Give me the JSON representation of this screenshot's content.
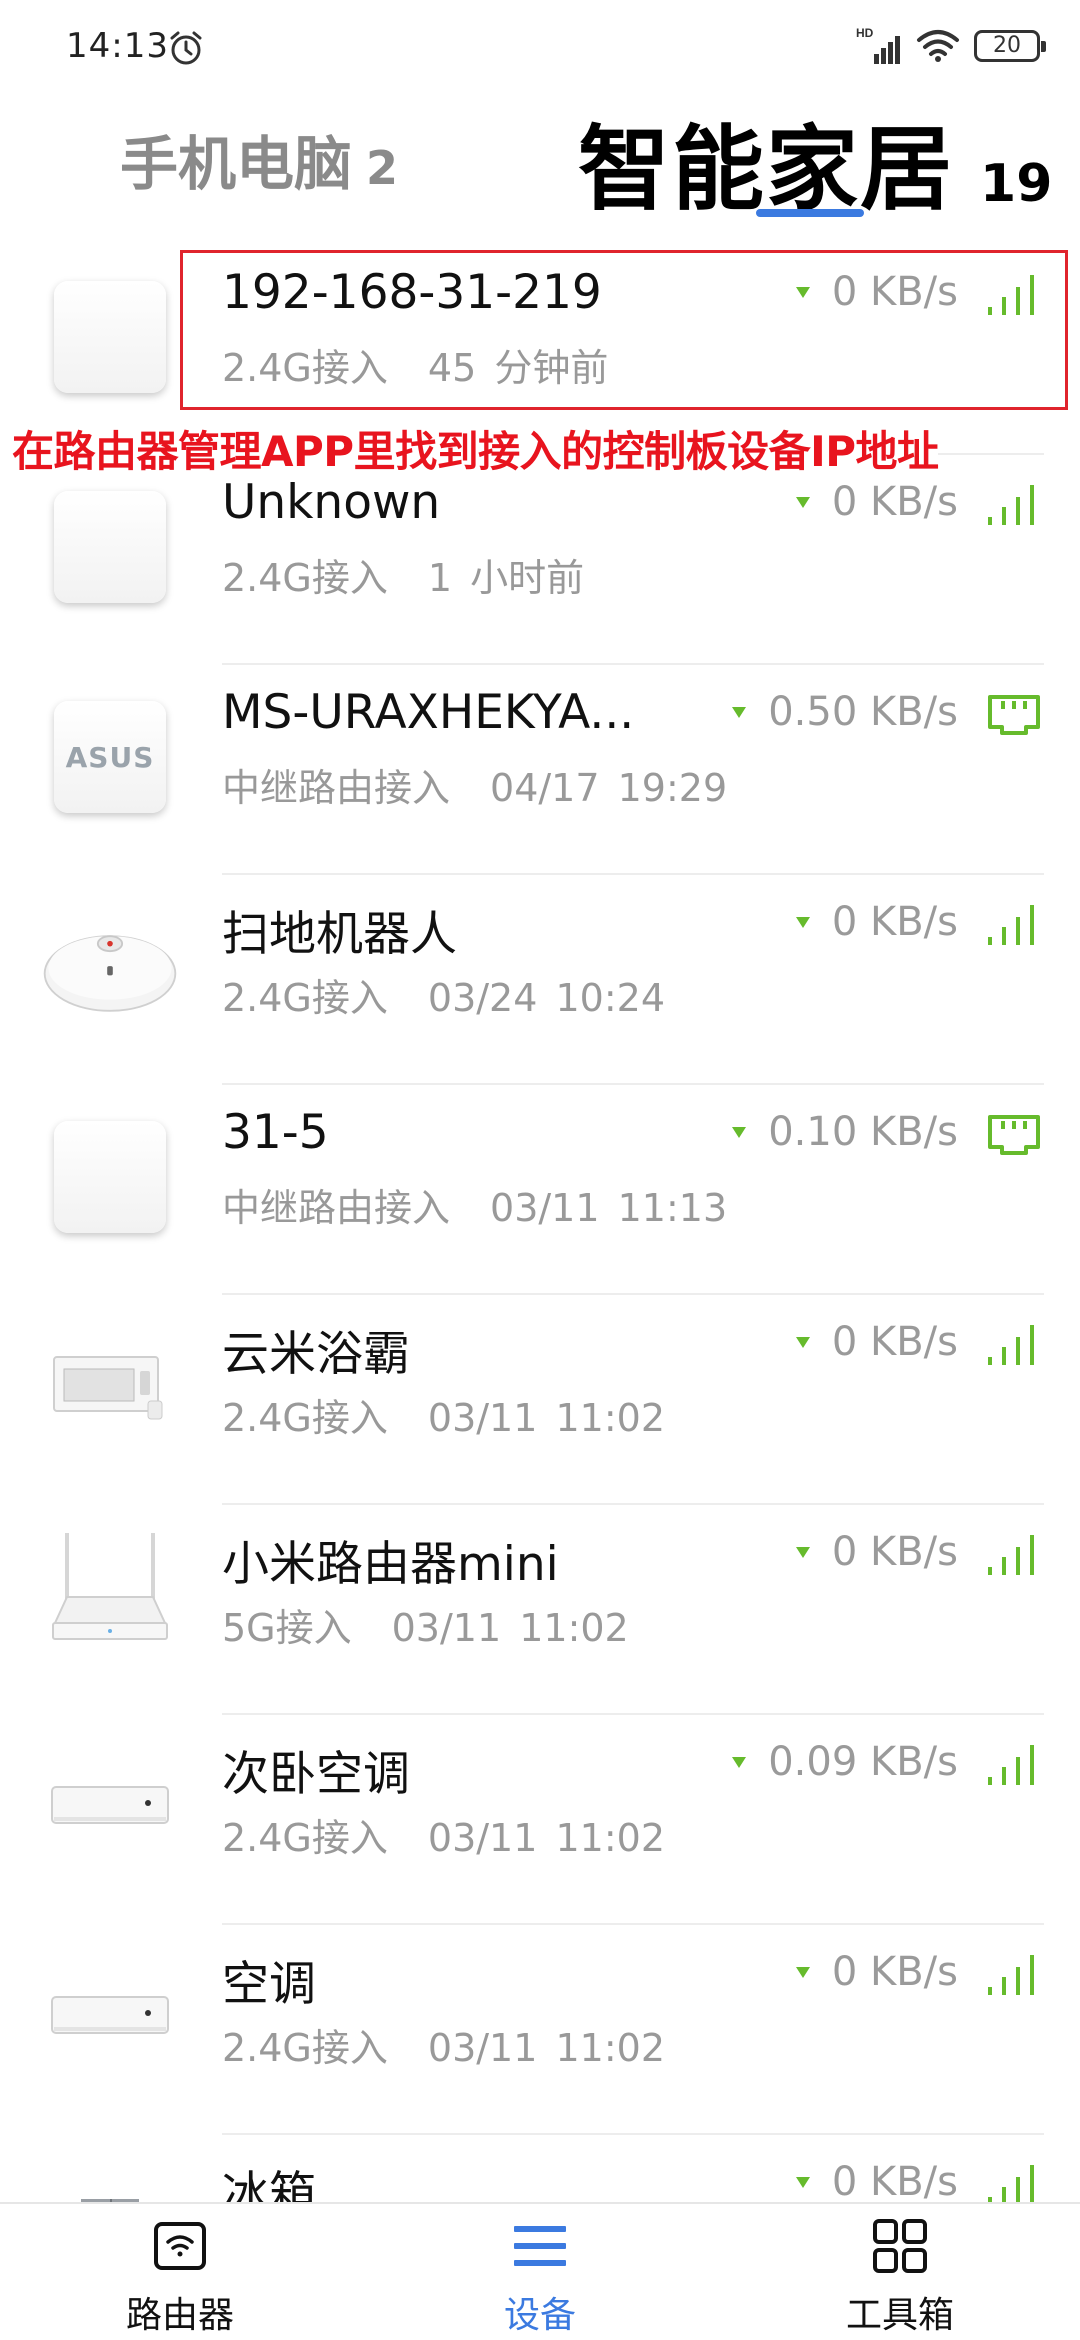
{
  "status": {
    "time": "14:13",
    "network": "HD",
    "battery": "20"
  },
  "tabs": {
    "phone_pc": {
      "label": "手机电脑",
      "count": "2"
    },
    "smart_home": {
      "label": "智能家居",
      "count": "19"
    }
  },
  "annotation": "在路由器管理APP里找到接入的控制板设备IP地址",
  "devices": [
    {
      "name": "192-168-31-219",
      "access": "2.4G接入",
      "time": "45 分钟前",
      "speed": "0 KB/s",
      "icon": "blank-device-icon",
      "signal": "wifi"
    },
    {
      "name": "Unknown",
      "access": "2.4G接入",
      "time": "1 小时前",
      "speed": "0 KB/s",
      "icon": "blank-device-icon",
      "signal": "wifi"
    },
    {
      "name": "MS-URAXHEKYA...",
      "access": "中继路由接入",
      "time": "04/17 19:29",
      "speed": "0.50 KB/s",
      "icon": "asus-device-icon",
      "icon_text": "ASUS",
      "signal": "ethernet"
    },
    {
      "name": "扫地机器人",
      "access": "2.4G接入",
      "time": "03/24 10:24",
      "speed": "0 KB/s",
      "icon": "robot-vacuum-icon",
      "signal": "wifi"
    },
    {
      "name": "31-5",
      "access": "中继路由接入",
      "time": "03/11 11:13",
      "speed": "0.10 KB/s",
      "icon": "blank-device-icon",
      "signal": "ethernet"
    },
    {
      "name": "云米浴霸",
      "access": "2.4G接入",
      "time": "03/11 11:02",
      "speed": "0 KB/s",
      "icon": "bath-heater-icon",
      "signal": "wifi"
    },
    {
      "name": "小米路由器mini",
      "access": "5G接入",
      "time": "03/11 11:02",
      "speed": "0 KB/s",
      "icon": "router-device-icon",
      "signal": "wifi"
    },
    {
      "name": "次卧空调",
      "access": "2.4G接入",
      "time": "03/11 11:02",
      "speed": "0.09 KB/s",
      "icon": "air-conditioner-icon",
      "signal": "wifi"
    },
    {
      "name": "空调",
      "access": "2.4G接入",
      "time": "03/11 11:02",
      "speed": "0 KB/s",
      "icon": "air-conditioner-icon",
      "signal": "wifi"
    },
    {
      "name": "冰箱",
      "access": "",
      "time": "",
      "speed": "0 KB/s",
      "icon": "fridge-icon",
      "signal": "wifi"
    }
  ],
  "nav": {
    "router": "路由器",
    "devices": "设备",
    "tools": "工具箱"
  },
  "colors": {
    "accent": "#3b7ae0",
    "signal_green": "#66bb2c",
    "annotation_red": "#e8141e"
  }
}
